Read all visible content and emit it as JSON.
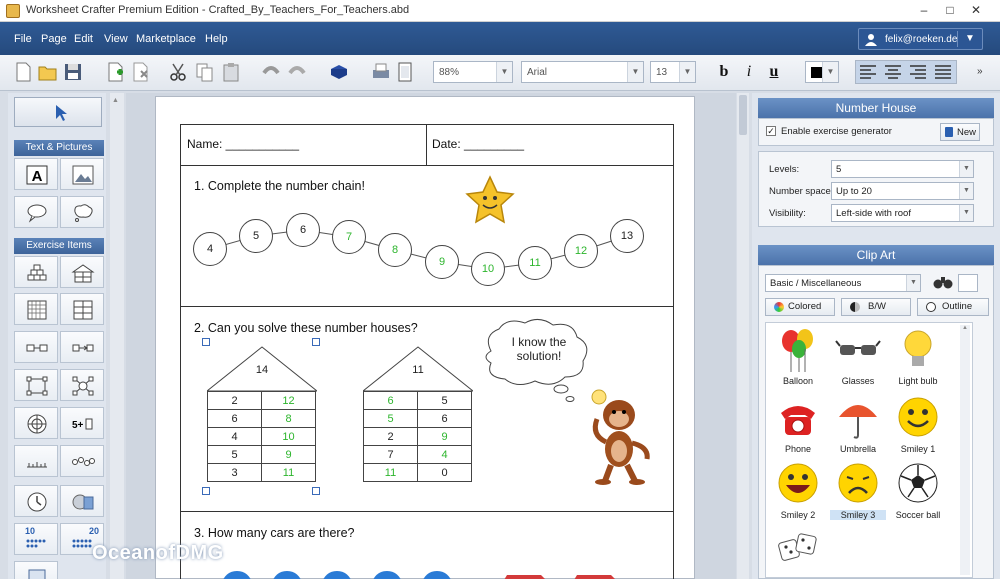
{
  "window": {
    "title": "Worksheet Crafter Premium Edition - Crafted_By_Teachers_For_Teachers.abd",
    "minimize": "–",
    "maximize": "□",
    "close": "✕"
  },
  "menu": {
    "items": [
      "File",
      "Page",
      "Edit",
      "View",
      "Marketplace",
      "Help"
    ],
    "user": "felix@roeken.de"
  },
  "toolbar": {
    "zoom": "88%",
    "font": "Arial",
    "font_size": "13",
    "bold": "b",
    "italic": "i",
    "underline": "u",
    "more": "»"
  },
  "left_panel": {
    "text_pictures": "Text & Pictures",
    "exercise_items": "Exercise Items",
    "number_badges": [
      "10",
      "20"
    ]
  },
  "worksheet": {
    "name_label": "Name: ___________",
    "date_label": "Date: _________",
    "q1": "1. Complete the number chain!",
    "chain": [
      {
        "v": "4",
        "g": false
      },
      {
        "v": "5",
        "g": false
      },
      {
        "v": "6",
        "g": false
      },
      {
        "v": "7",
        "g": true
      },
      {
        "v": "8",
        "g": true
      },
      {
        "v": "9",
        "g": true
      },
      {
        "v": "10",
        "g": true
      },
      {
        "v": "11",
        "g": true
      },
      {
        "v": "12",
        "g": true
      },
      {
        "v": "13",
        "g": false
      }
    ],
    "q2": "2. Can you solve these number houses?",
    "thought": [
      "I know the",
      "solution!"
    ],
    "house1": {
      "roof": "14",
      "rows": [
        [
          "2",
          "12"
        ],
        [
          "6",
          "8"
        ],
        [
          "4",
          "10"
        ],
        [
          "5",
          "9"
        ],
        [
          "3",
          "11"
        ]
      ],
      "green_col": 1
    },
    "house2": {
      "roof": "11",
      "rows": [
        [
          "6",
          "5"
        ],
        [
          "5",
          "6"
        ],
        [
          "2",
          "9"
        ],
        [
          "7",
          "4"
        ],
        [
          "11",
          "0"
        ]
      ],
      "green_col": 0
    },
    "q3": "3. How many cars are there?"
  },
  "number_house": {
    "title": "Number House",
    "enable_label": "Enable exercise generator",
    "new_button": "New",
    "levels_label": "Levels:",
    "levels_value": "5",
    "space_label": "Number space:",
    "space_value": "Up to 20",
    "visibility_label": "Visibility:",
    "visibility_value": "Left-side with roof"
  },
  "clip_art": {
    "title": "Clip Art",
    "category": "Basic / Miscellaneous",
    "tabs": [
      "Colored",
      "B/W",
      "Outline"
    ],
    "items": [
      "Balloon",
      "Glasses",
      "Light bulb",
      "Phone",
      "Umbrella",
      "Smiley 1",
      "Smiley 2",
      "Smiley 3",
      "Soccer ball"
    ]
  },
  "watermark": "OceanofDMG",
  "colors": {
    "menubar": "#2a5189",
    "accent_green": "#2db52d",
    "panel_header": "#5a82b8"
  }
}
